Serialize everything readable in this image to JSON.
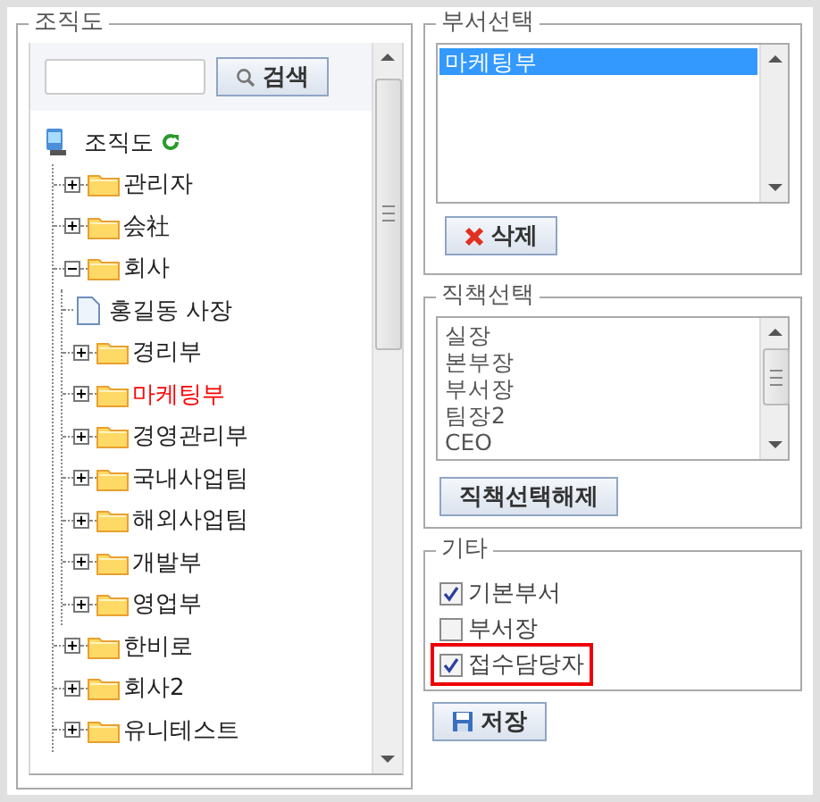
{
  "org_panel": {
    "legend": "조직도",
    "search": {
      "button": "검색"
    },
    "tree": {
      "label": "조직도",
      "kind": "root",
      "children": [
        {
          "label": "관리자",
          "kind": "folder",
          "expanded": false,
          "selected": false
        },
        {
          "label": "会社",
          "kind": "folder",
          "expanded": false,
          "selected": false
        },
        {
          "label": "회사",
          "kind": "folder",
          "expanded": true,
          "selected": false,
          "children": [
            {
              "label": "홍길동 사장",
              "kind": "person",
              "selected": false
            },
            {
              "label": "경리부",
              "kind": "folder",
              "expanded": false,
              "selected": false
            },
            {
              "label": "마케팅부",
              "kind": "folder",
              "expanded": false,
              "selected": true
            },
            {
              "label": "경영관리부",
              "kind": "folder",
              "expanded": false,
              "selected": false
            },
            {
              "label": "국내사업팀",
              "kind": "folder",
              "expanded": false,
              "selected": false
            },
            {
              "label": "해외사업팀",
              "kind": "folder",
              "expanded": false,
              "selected": false
            },
            {
              "label": "개발부",
              "kind": "folder",
              "expanded": false,
              "selected": false
            },
            {
              "label": "영업부",
              "kind": "folder",
              "expanded": false,
              "selected": false
            }
          ]
        },
        {
          "label": "한비로",
          "kind": "folder",
          "expanded": false,
          "selected": false
        },
        {
          "label": "회사2",
          "kind": "folder",
          "expanded": false,
          "selected": false
        },
        {
          "label": "유니테스트",
          "kind": "folder",
          "expanded": false,
          "selected": false
        }
      ]
    }
  },
  "dept_panel": {
    "legend": "부서선택",
    "items": [
      {
        "label": "마케팅부",
        "selected": true
      }
    ],
    "button": "삭제"
  },
  "position_panel": {
    "legend": "직책선택",
    "items": [
      {
        "label": "실장",
        "selected": false
      },
      {
        "label": "본부장",
        "selected": false
      },
      {
        "label": "부서장",
        "selected": false
      },
      {
        "label": "팀장2",
        "selected": false
      },
      {
        "label": "CEO",
        "selected": false
      }
    ],
    "button": "직책선택해제"
  },
  "etc_panel": {
    "legend": "기타",
    "options": [
      {
        "label": "기본부서",
        "checked": true,
        "highlighted": false
      },
      {
        "label": "부서장",
        "checked": false,
        "highlighted": false
      },
      {
        "label": "접수담당자",
        "checked": true,
        "highlighted": true
      }
    ]
  },
  "save_button": "저장"
}
